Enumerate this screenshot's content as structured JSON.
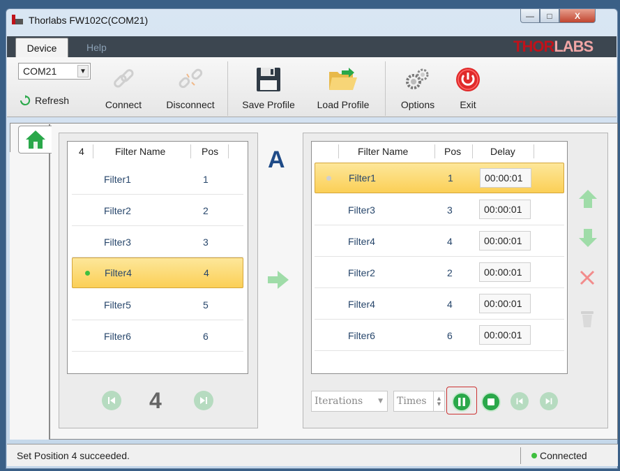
{
  "window": {
    "title": "Thorlabs FW102C(COM21)",
    "min_glyph": "—",
    "max_glyph": "□",
    "close_glyph": "X"
  },
  "menu": {
    "tabs": [
      {
        "label": "Device",
        "active": true
      },
      {
        "label": "Help",
        "active": false
      }
    ],
    "brand_part1": "THOR",
    "brand_part2": "LABS"
  },
  "ribbon": {
    "port_value": "COM21",
    "refresh_label": "Refresh",
    "buttons": [
      {
        "label": "Connect",
        "icon": "chain-link-icon",
        "enabled": false
      },
      {
        "label": "Disconnect",
        "icon": "broken-chain-icon",
        "enabled": false
      },
      {
        "label": "Save Profile",
        "icon": "floppy-disk-icon",
        "enabled": true
      },
      {
        "label": "Load Profile",
        "icon": "open-folder-icon",
        "enabled": true
      },
      {
        "label": "Options",
        "icon": "gears-icon",
        "enabled": true
      },
      {
        "label": "Exit",
        "icon": "power-icon",
        "enabled": true
      }
    ]
  },
  "filter_list": {
    "header_count": "4",
    "header_name": "Filter Name",
    "header_pos": "Pos",
    "rows": [
      {
        "name": "Filter1",
        "pos": "1",
        "selected": false
      },
      {
        "name": "Filter2",
        "pos": "2",
        "selected": false
      },
      {
        "name": "Filter3",
        "pos": "3",
        "selected": false
      },
      {
        "name": "Filter4",
        "pos": "4",
        "selected": true
      },
      {
        "name": "Filter5",
        "pos": "5",
        "selected": false
      },
      {
        "name": "Filter6",
        "pos": "6",
        "selected": false
      }
    ],
    "current_position": "4"
  },
  "mode_label": "A",
  "sequence": {
    "header_name": "Filter Name",
    "header_pos": "Pos",
    "header_delay": "Delay",
    "rows": [
      {
        "name": "Filter1",
        "pos": "1",
        "delay": "00:00:01",
        "selected": true
      },
      {
        "name": "Filter3",
        "pos": "3",
        "delay": "00:00:01",
        "selected": false
      },
      {
        "name": "Filter4",
        "pos": "4",
        "delay": "00:00:01",
        "selected": false
      },
      {
        "name": "Filter2",
        "pos": "2",
        "delay": "00:00:01",
        "selected": false
      },
      {
        "name": "Filter4",
        "pos": "4",
        "delay": "00:00:01",
        "selected": false
      },
      {
        "name": "Filter6",
        "pos": "6",
        "delay": "00:00:01",
        "selected": false
      }
    ],
    "iterations_placeholder": "Iterations",
    "times_placeholder": "Times"
  },
  "status": {
    "message": "Set Position 4 succeeded.",
    "connection": "Connected"
  },
  "colors": {
    "accent_green": "#2aa84a",
    "brand_red": "#c0121a",
    "selection_yellow": "#fbcf56"
  }
}
